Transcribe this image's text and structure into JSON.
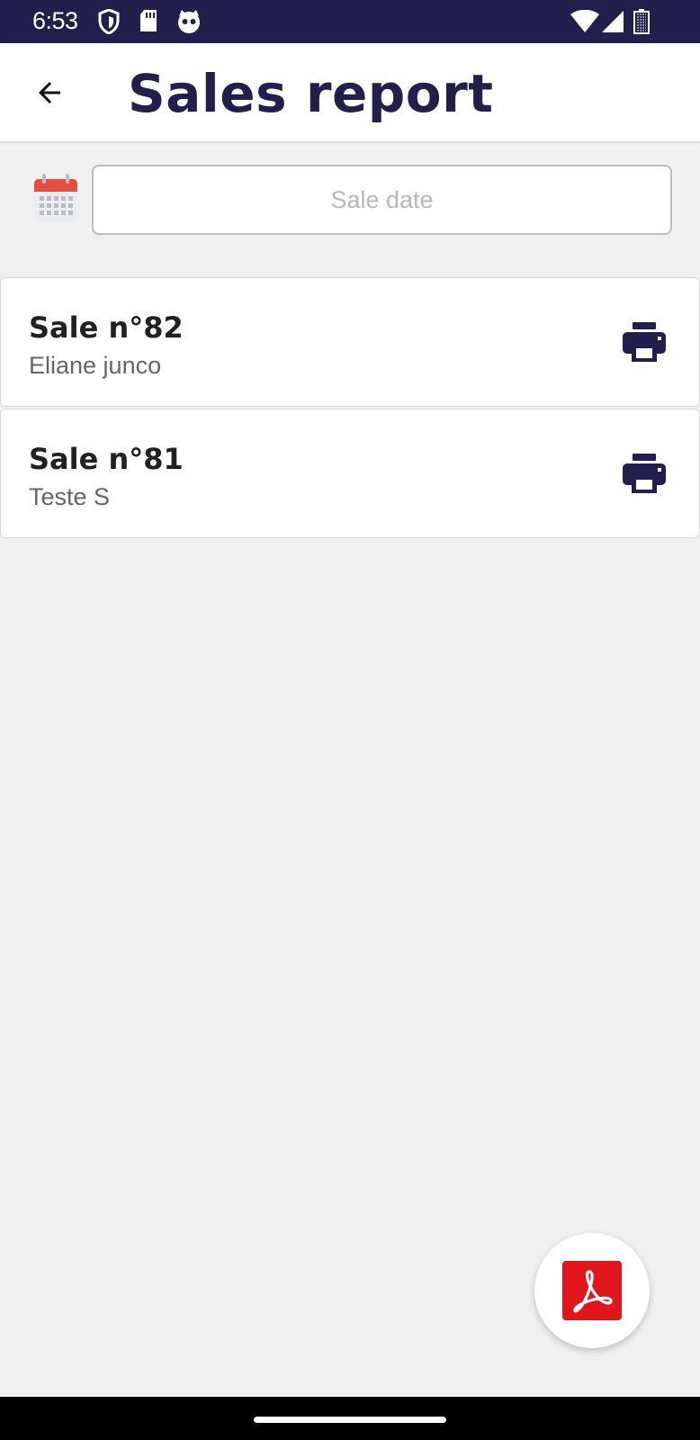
{
  "status_bar": {
    "time": "6:53",
    "left_icons": [
      "shield-icon",
      "sd-card-icon",
      "cat-face-icon"
    ],
    "right_icons": [
      "wifi-icon",
      "signal-icon",
      "battery-icon"
    ]
  },
  "app_bar": {
    "title": "Sales report",
    "back_icon": "arrow-left-icon"
  },
  "filter": {
    "date_placeholder": "Sale date",
    "date_value": "",
    "calendar_icon": "calendar-icon"
  },
  "sales": [
    {
      "title": "Sale n°82",
      "customer": "Eliane junco",
      "action_icon": "printer-icon"
    },
    {
      "title": "Sale n°81",
      "customer": "Teste S",
      "action_icon": "printer-icon"
    }
  ],
  "fab": {
    "icon": "pdf-icon"
  },
  "colors": {
    "status_bar": "#221f4d",
    "title": "#221f4d",
    "background": "#f0f0f0",
    "pdf_red": "#e0161b",
    "calendar_red": "#e84c3d"
  }
}
